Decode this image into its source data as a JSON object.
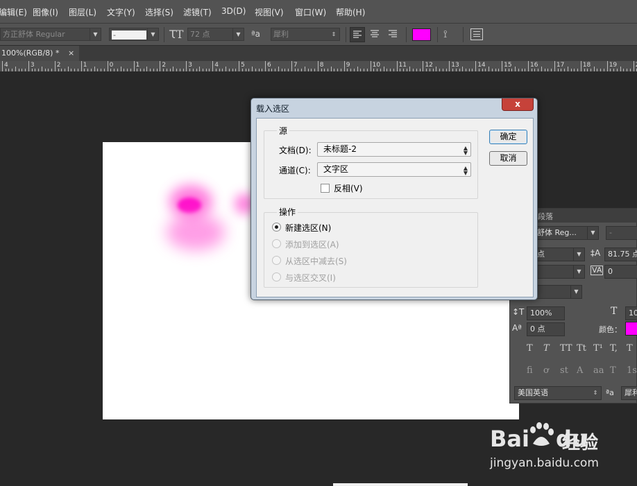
{
  "menu": [
    "编辑(E)",
    "图像(I)",
    "图层(L)",
    "文字(Y)",
    "选择(S)",
    "滤镜(T)",
    "3D(D)",
    "视图(V)",
    "窗口(W)",
    "帮助(H)"
  ],
  "options": {
    "font_family": "方正舒体 Regular",
    "font_style": "-",
    "font_size": "72 点",
    "aa_label": "ªa",
    "antialias": "犀利",
    "text_color": "#ff00ff"
  },
  "document": {
    "tab_title": "100%(RGB/8) *",
    "close_glyph": "×"
  },
  "ruler": {
    "labels": [
      "4",
      "3",
      "2",
      "1",
      "0",
      "1",
      "2",
      "3",
      "4",
      "5",
      "6",
      "7",
      "8",
      "9",
      "10",
      "11",
      "12",
      "13",
      "14",
      "15",
      "16",
      "17",
      "18",
      "19",
      "20"
    ]
  },
  "dialog": {
    "title": "载入选区",
    "close": "x",
    "source": {
      "group_label": "源",
      "document_label": "文档(D):",
      "document_value": "未标题-2",
      "channel_label": "通道(C):",
      "channel_value": "文字区",
      "invert_label": "反相(V)"
    },
    "operation": {
      "group_label": "操作",
      "options": [
        {
          "label": "新建选区(N)",
          "selected": true,
          "enabled": true
        },
        {
          "label": "添加到选区(A)",
          "selected": false,
          "enabled": false
        },
        {
          "label": "从选区中减去(S)",
          "selected": false,
          "enabled": false
        },
        {
          "label": "与选区交叉(I)",
          "selected": false,
          "enabled": false
        }
      ]
    },
    "ok_label": "确定",
    "cancel_label": "取消"
  },
  "character_panel": {
    "tab_paragraph": "段落",
    "font": "舒体 Reg...",
    "style": "-",
    "size": "点",
    "leading": "81.75 点",
    "tracking": "0",
    "vertical_scale": "100%",
    "horizontal_scale": "10",
    "baseline_shift": "0 点",
    "color_label": "颜色：",
    "color": "#ff00ff",
    "language": "美国英语",
    "aa_label": "ªa",
    "antialias": "犀利",
    "style_buttons": [
      "T",
      "T",
      "TT",
      "Tt",
      "T¹",
      "T,",
      "T"
    ],
    "opentype_buttons": [
      "fi",
      "ơ",
      "st",
      "A",
      "aa",
      "T",
      "1st"
    ]
  },
  "watermark": {
    "brand": "Bai",
    "brand_suffix": "du",
    "product": "经验",
    "url": "jingyan.baidu.com"
  }
}
